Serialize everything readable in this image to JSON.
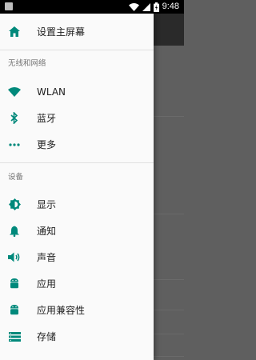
{
  "status_bar": {
    "time": "9:48",
    "icons": [
      "notification-icon",
      "wifi-icon",
      "cellular-icon",
      "battery-icon"
    ]
  },
  "colors": {
    "accent": "#00897b",
    "drawer_bg": "#fafafa",
    "text_primary": "#212121",
    "text_secondary": "#757575"
  },
  "drawer": {
    "home": {
      "label": "设置主屏幕",
      "icon": "home-icon"
    },
    "sections": [
      {
        "header": "无线和网络",
        "items": [
          {
            "label": "WLAN",
            "icon": "wifi-icon"
          },
          {
            "label": "蓝牙",
            "icon": "bluetooth-icon"
          },
          {
            "label": "更多",
            "icon": "more-icon"
          }
        ]
      },
      {
        "header": "设备",
        "items": [
          {
            "label": "显示",
            "icon": "brightness-icon"
          },
          {
            "label": "通知",
            "icon": "bell-icon"
          },
          {
            "label": "声音",
            "icon": "volume-icon"
          },
          {
            "label": "应用",
            "icon": "android-icon"
          },
          {
            "label": "应用兼容性",
            "icon": "android-icon"
          },
          {
            "label": "存储",
            "icon": "storage-icon"
          }
        ]
      }
    ]
  }
}
